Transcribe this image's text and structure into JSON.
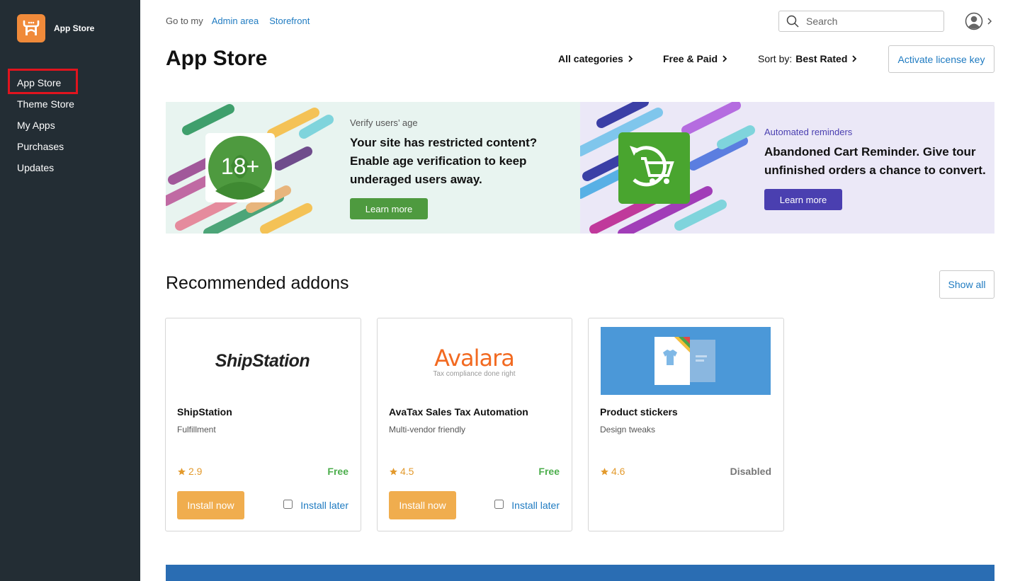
{
  "sidebar": {
    "brand": "App Store",
    "items": [
      {
        "label": "App Store",
        "active": true
      },
      {
        "label": "Theme Store"
      },
      {
        "label": "My Apps"
      },
      {
        "label": "Purchases"
      },
      {
        "label": "Updates"
      }
    ]
  },
  "header": {
    "goto_label": "Go to my",
    "admin_link": "Admin area",
    "storefront_link": "Storefront",
    "search_placeholder": "Search",
    "title": "App Store",
    "filters": {
      "categories": "All categories",
      "pricing": "Free & Paid",
      "sort_prefix": "Sort by:",
      "sort_value": "Best Rated"
    },
    "license_button": "Activate license key"
  },
  "banners": [
    {
      "kicker": "Verify users’ age",
      "headline_lines": [
        "Your site has restricted content?",
        "Enable age verification to keep",
        "underaged users away."
      ],
      "button": "Learn more",
      "badge": "18+",
      "accent": "#4e9a3f"
    },
    {
      "kicker": "Automated reminders",
      "headline_lines": [
        "Abandoned Cart Reminder. Give tour",
        "unfinished orders a chance to convert."
      ],
      "button": "Learn more",
      "accent": "#4a3fb0"
    }
  ],
  "recommended": {
    "title": "Recommended addons",
    "show_all": "Show all",
    "cards": [
      {
        "logo_text": "ShipStation",
        "name": "ShipStation",
        "category": "Fulfillment",
        "rating": "2.9",
        "price": "Free",
        "install": "Install now",
        "later": "Install later"
      },
      {
        "logo_text": "Avalara",
        "logo_sub": "Tax compliance done right",
        "name": "AvaTax Sales Tax Automation",
        "category": "Multi-vendor friendly",
        "rating": "4.5",
        "price": "Free",
        "install": "Install now",
        "later": "Install later"
      },
      {
        "name": "Product stickers",
        "category": "Design tweaks",
        "rating": "4.6",
        "price": "Disabled"
      }
    ]
  },
  "colors": {
    "sidebar_bg": "#232d34",
    "link": "#1f7bc1",
    "install": "#f0ad4e",
    "free": "#4cae4c",
    "disabled": "#777777"
  }
}
